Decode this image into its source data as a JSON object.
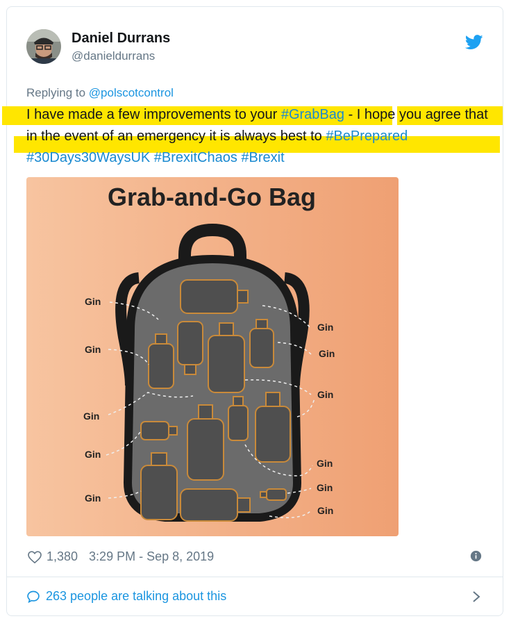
{
  "user": {
    "name": "Daniel Durrans",
    "handle": "@danieldurrans"
  },
  "reply": {
    "prefix": "Replying to ",
    "to": "@polscotcontrol"
  },
  "tweet": {
    "t1": "I have made a few improvements to your ",
    "tag1": "#GrabBag",
    "t2": " - I hope you agree that in the event of an emergency it is always best to ",
    "tag2": "#BePrepared",
    "tag3": "#30Days30WaysUK",
    "tag4": "#BrexitChaos",
    "tag5": "#Brexit"
  },
  "image": {
    "title": "Grab-and-Go Bag",
    "label": "Gin",
    "colors": {
      "bg_light": "#f7c7a2",
      "bg_dark": "#efa071",
      "bag": "#6b6b6b",
      "bottle": "#4f4f4f",
      "outline": "#c98a3a"
    }
  },
  "meta": {
    "likes": "1,380",
    "timestamp": "3:29 PM - Sep 8, 2019"
  },
  "footer": {
    "talking": "263 people are talking about this"
  },
  "colors": {
    "link": "#1b95e0",
    "highlight": "#ffe600",
    "muted": "#657786"
  }
}
